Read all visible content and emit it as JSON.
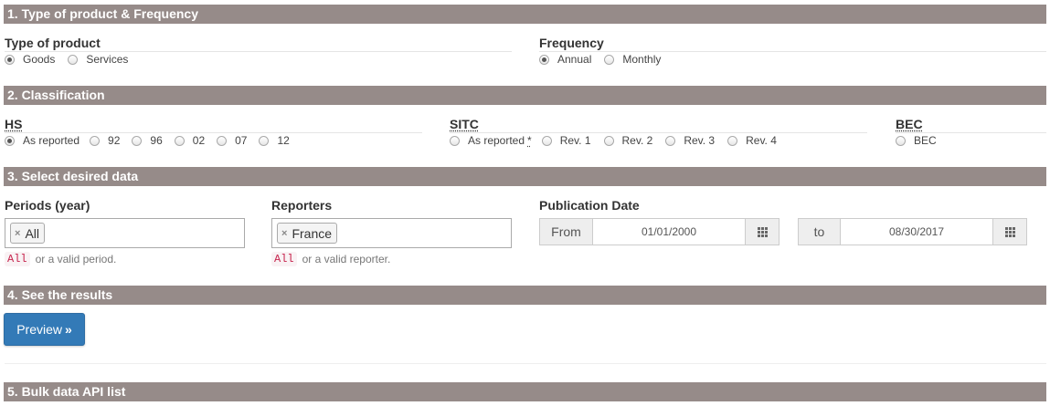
{
  "sections": {
    "s1": "1. Type of product & Frequency",
    "s2": "2. Classification",
    "s3": "3. Select desired data",
    "s4": "4. See the results",
    "s5": "5. Bulk data API list"
  },
  "product": {
    "label": "Type of product",
    "options": [
      {
        "label": "Goods",
        "checked": true
      },
      {
        "label": "Services",
        "checked": false
      }
    ]
  },
  "frequency": {
    "label": "Frequency",
    "options": [
      {
        "label": "Annual",
        "checked": true
      },
      {
        "label": "Monthly",
        "checked": false
      }
    ]
  },
  "classification": {
    "hs": {
      "label": "HS",
      "options": [
        {
          "label": "As reported",
          "checked": true
        },
        {
          "label": "92",
          "checked": false
        },
        {
          "label": "96",
          "checked": false
        },
        {
          "label": "02",
          "checked": false
        },
        {
          "label": "07",
          "checked": false
        },
        {
          "label": "12",
          "checked": false
        }
      ]
    },
    "sitc": {
      "label": "SITC",
      "options": [
        {
          "label": "As reported",
          "checked": false,
          "marker": "*"
        },
        {
          "label": "Rev. 1",
          "checked": false
        },
        {
          "label": "Rev. 2",
          "checked": false
        },
        {
          "label": "Rev. 3",
          "checked": false
        },
        {
          "label": "Rev. 4",
          "checked": false
        }
      ]
    },
    "bec": {
      "label": "BEC",
      "options": [
        {
          "label": "BEC",
          "checked": false
        }
      ]
    }
  },
  "periods": {
    "label": "Periods (year)",
    "tag": "All",
    "help_code": "All",
    "help_text": "or a valid period."
  },
  "reporters": {
    "label": "Reporters",
    "tag": "France",
    "help_code": "All",
    "help_text": "or a valid reporter."
  },
  "publication": {
    "label": "Publication Date",
    "from_label": "From",
    "from_value": "01/01/2000",
    "to_label": "to",
    "to_value": "08/30/2017"
  },
  "results": {
    "preview_label": "Preview",
    "preview_icon": "double-chevron-right-icon"
  },
  "colors": {
    "section_bar": "#968b89",
    "primary": "#337ab7",
    "code_text": "#c7254e"
  }
}
